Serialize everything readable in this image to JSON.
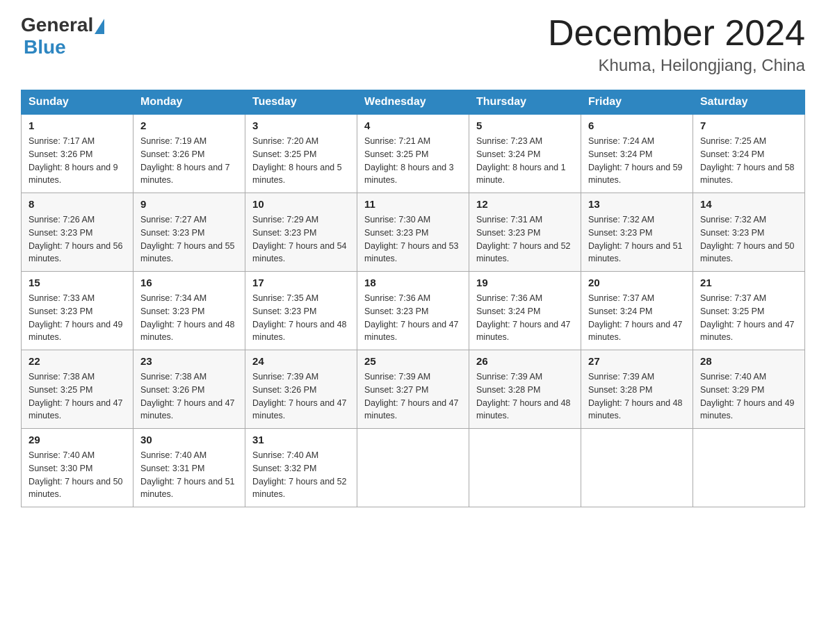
{
  "logo": {
    "general": "General",
    "blue": "Blue"
  },
  "title": "December 2024",
  "subtitle": "Khuma, Heilongjiang, China",
  "days_header": [
    "Sunday",
    "Monday",
    "Tuesday",
    "Wednesday",
    "Thursday",
    "Friday",
    "Saturday"
  ],
  "weeks": [
    [
      {
        "num": "1",
        "sunrise": "7:17 AM",
        "sunset": "3:26 PM",
        "daylight": "8 hours and 9 minutes."
      },
      {
        "num": "2",
        "sunrise": "7:19 AM",
        "sunset": "3:26 PM",
        "daylight": "8 hours and 7 minutes."
      },
      {
        "num": "3",
        "sunrise": "7:20 AM",
        "sunset": "3:25 PM",
        "daylight": "8 hours and 5 minutes."
      },
      {
        "num": "4",
        "sunrise": "7:21 AM",
        "sunset": "3:25 PM",
        "daylight": "8 hours and 3 minutes."
      },
      {
        "num": "5",
        "sunrise": "7:23 AM",
        "sunset": "3:24 PM",
        "daylight": "8 hours and 1 minute."
      },
      {
        "num": "6",
        "sunrise": "7:24 AM",
        "sunset": "3:24 PM",
        "daylight": "7 hours and 59 minutes."
      },
      {
        "num": "7",
        "sunrise": "7:25 AM",
        "sunset": "3:24 PM",
        "daylight": "7 hours and 58 minutes."
      }
    ],
    [
      {
        "num": "8",
        "sunrise": "7:26 AM",
        "sunset": "3:23 PM",
        "daylight": "7 hours and 56 minutes."
      },
      {
        "num": "9",
        "sunrise": "7:27 AM",
        "sunset": "3:23 PM",
        "daylight": "7 hours and 55 minutes."
      },
      {
        "num": "10",
        "sunrise": "7:29 AM",
        "sunset": "3:23 PM",
        "daylight": "7 hours and 54 minutes."
      },
      {
        "num": "11",
        "sunrise": "7:30 AM",
        "sunset": "3:23 PM",
        "daylight": "7 hours and 53 minutes."
      },
      {
        "num": "12",
        "sunrise": "7:31 AM",
        "sunset": "3:23 PM",
        "daylight": "7 hours and 52 minutes."
      },
      {
        "num": "13",
        "sunrise": "7:32 AM",
        "sunset": "3:23 PM",
        "daylight": "7 hours and 51 minutes."
      },
      {
        "num": "14",
        "sunrise": "7:32 AM",
        "sunset": "3:23 PM",
        "daylight": "7 hours and 50 minutes."
      }
    ],
    [
      {
        "num": "15",
        "sunrise": "7:33 AM",
        "sunset": "3:23 PM",
        "daylight": "7 hours and 49 minutes."
      },
      {
        "num": "16",
        "sunrise": "7:34 AM",
        "sunset": "3:23 PM",
        "daylight": "7 hours and 48 minutes."
      },
      {
        "num": "17",
        "sunrise": "7:35 AM",
        "sunset": "3:23 PM",
        "daylight": "7 hours and 48 minutes."
      },
      {
        "num": "18",
        "sunrise": "7:36 AM",
        "sunset": "3:23 PM",
        "daylight": "7 hours and 47 minutes."
      },
      {
        "num": "19",
        "sunrise": "7:36 AM",
        "sunset": "3:24 PM",
        "daylight": "7 hours and 47 minutes."
      },
      {
        "num": "20",
        "sunrise": "7:37 AM",
        "sunset": "3:24 PM",
        "daylight": "7 hours and 47 minutes."
      },
      {
        "num": "21",
        "sunrise": "7:37 AM",
        "sunset": "3:25 PM",
        "daylight": "7 hours and 47 minutes."
      }
    ],
    [
      {
        "num": "22",
        "sunrise": "7:38 AM",
        "sunset": "3:25 PM",
        "daylight": "7 hours and 47 minutes."
      },
      {
        "num": "23",
        "sunrise": "7:38 AM",
        "sunset": "3:26 PM",
        "daylight": "7 hours and 47 minutes."
      },
      {
        "num": "24",
        "sunrise": "7:39 AM",
        "sunset": "3:26 PM",
        "daylight": "7 hours and 47 minutes."
      },
      {
        "num": "25",
        "sunrise": "7:39 AM",
        "sunset": "3:27 PM",
        "daylight": "7 hours and 47 minutes."
      },
      {
        "num": "26",
        "sunrise": "7:39 AM",
        "sunset": "3:28 PM",
        "daylight": "7 hours and 48 minutes."
      },
      {
        "num": "27",
        "sunrise": "7:39 AM",
        "sunset": "3:28 PM",
        "daylight": "7 hours and 48 minutes."
      },
      {
        "num": "28",
        "sunrise": "7:40 AM",
        "sunset": "3:29 PM",
        "daylight": "7 hours and 49 minutes."
      }
    ],
    [
      {
        "num": "29",
        "sunrise": "7:40 AM",
        "sunset": "3:30 PM",
        "daylight": "7 hours and 50 minutes."
      },
      {
        "num": "30",
        "sunrise": "7:40 AM",
        "sunset": "3:31 PM",
        "daylight": "7 hours and 51 minutes."
      },
      {
        "num": "31",
        "sunrise": "7:40 AM",
        "sunset": "3:32 PM",
        "daylight": "7 hours and 52 minutes."
      },
      null,
      null,
      null,
      null
    ]
  ],
  "labels": {
    "sunrise": "Sunrise:",
    "sunset": "Sunset:",
    "daylight": "Daylight:"
  }
}
